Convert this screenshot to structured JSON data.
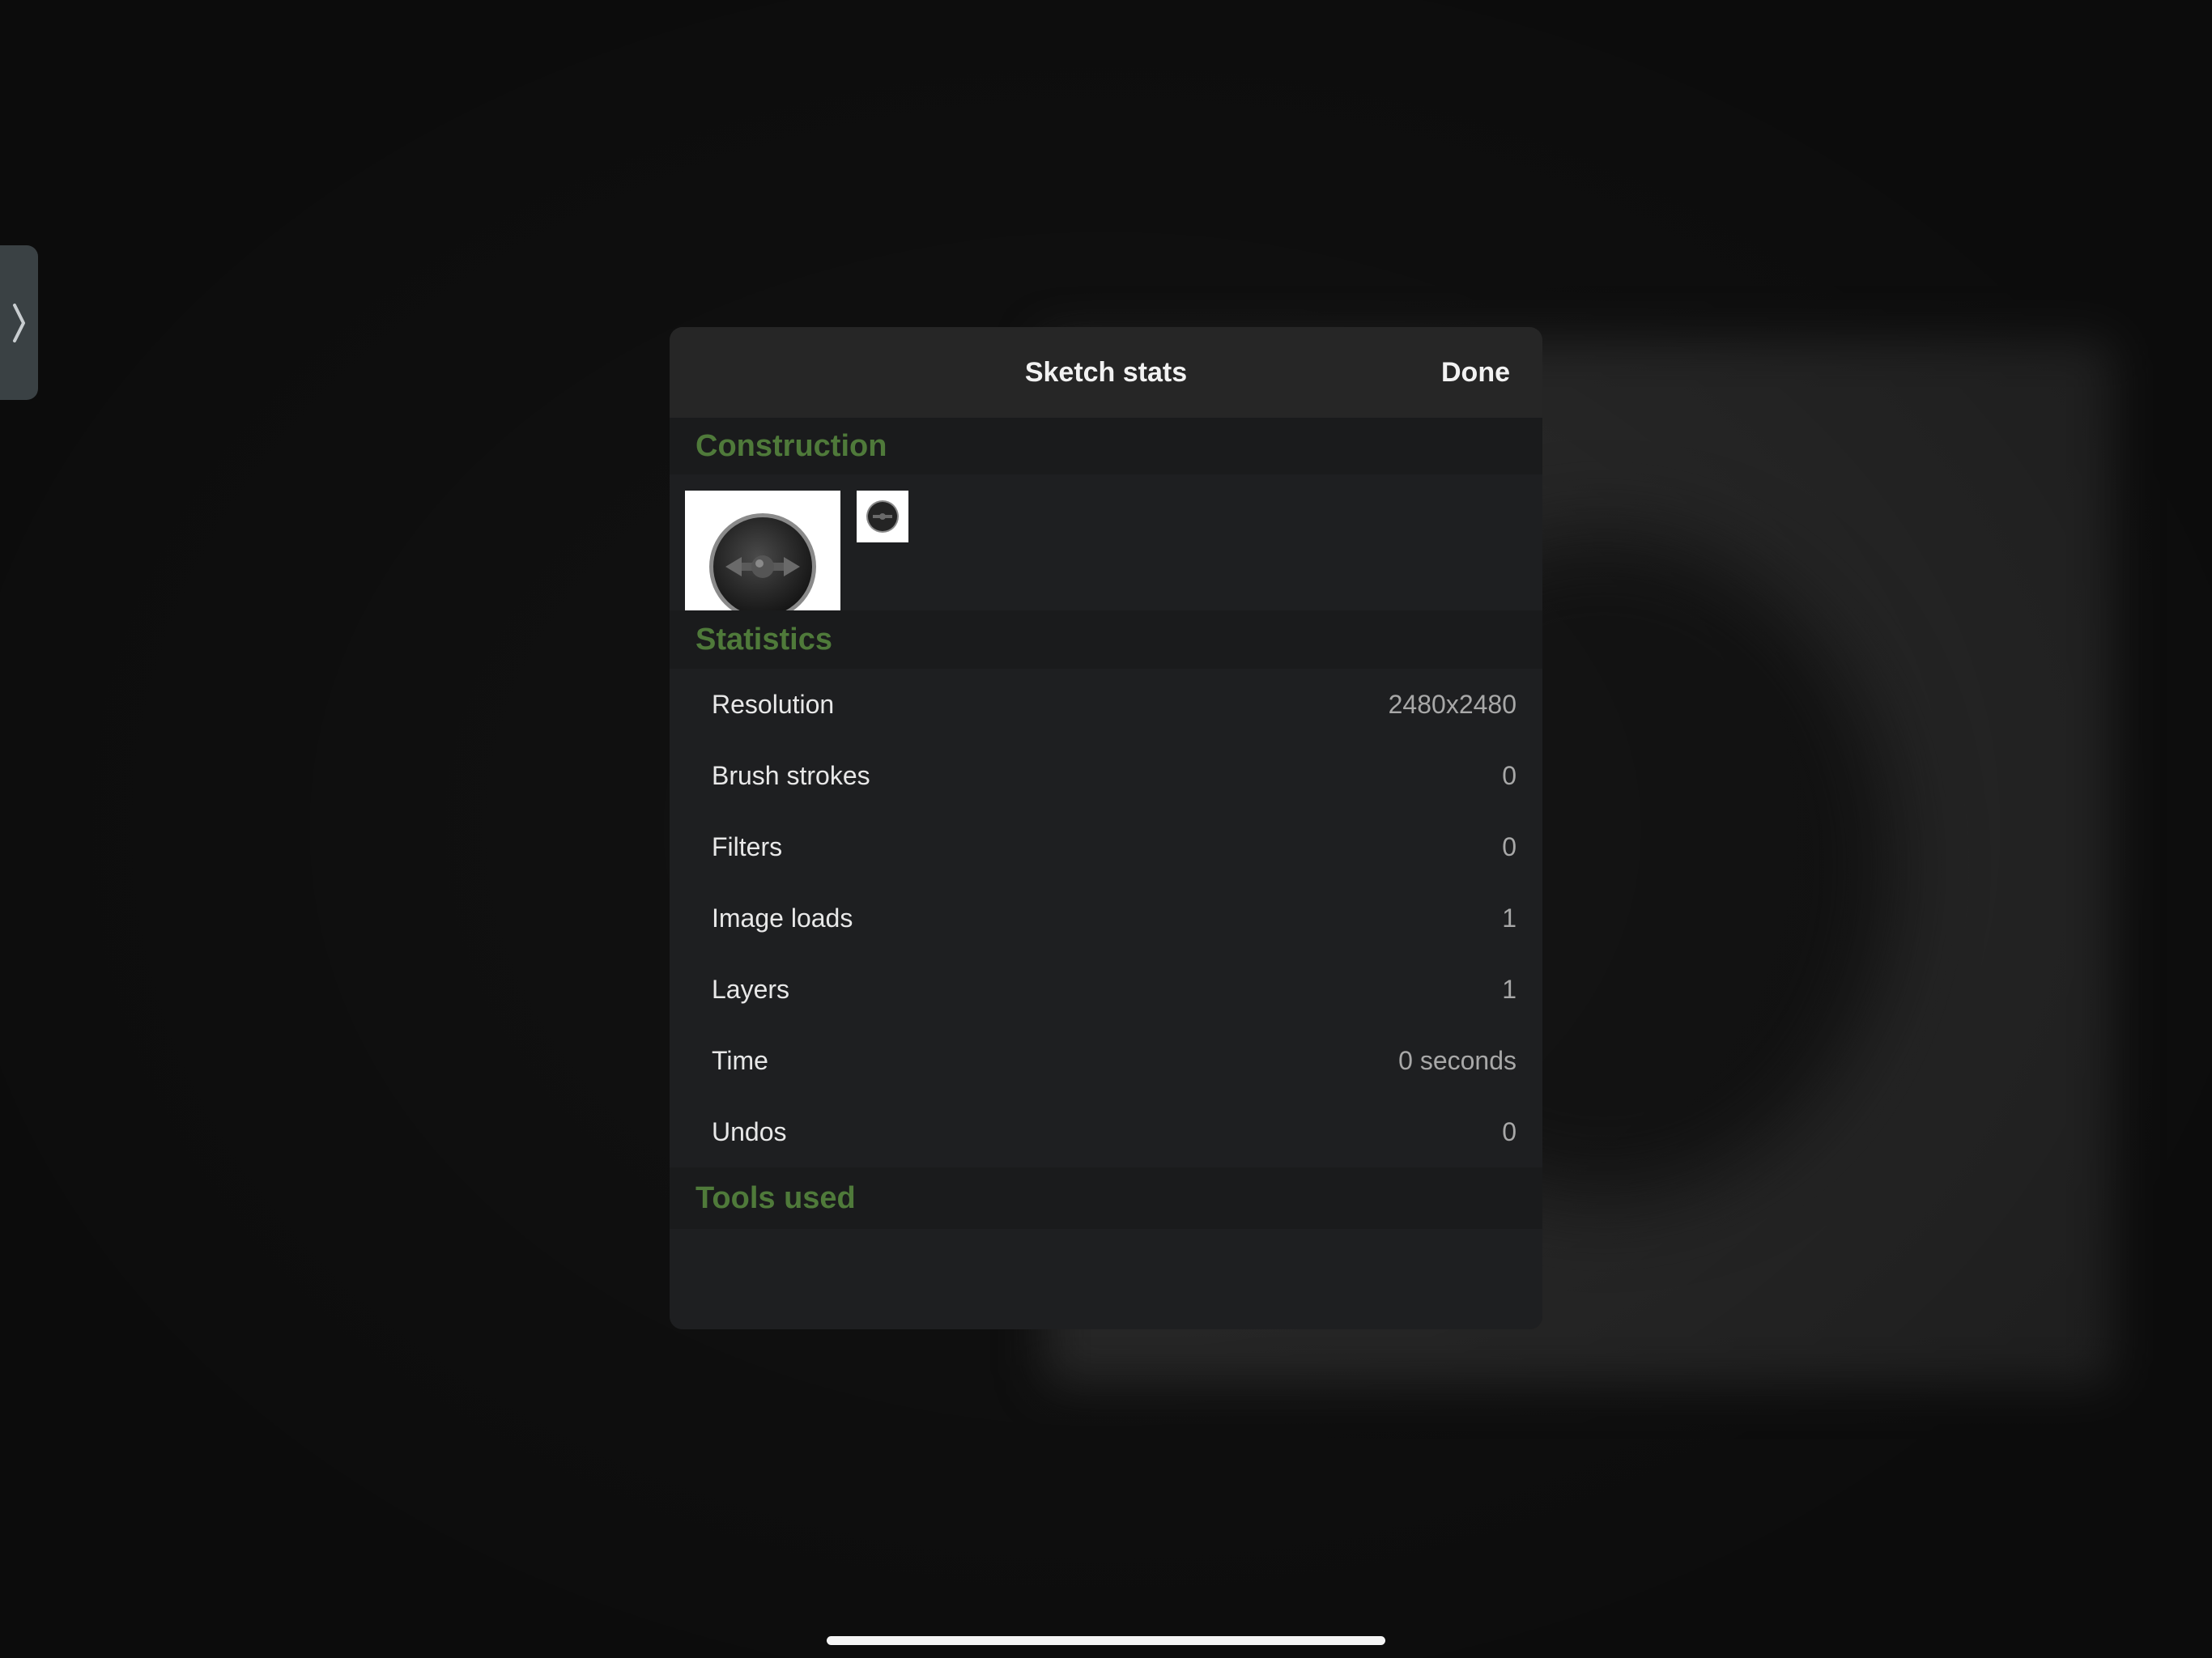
{
  "modal": {
    "title": "Sketch stats",
    "done_label": "Done"
  },
  "sections": {
    "construction": "Construction",
    "statistics": "Statistics",
    "tools_used": "Tools used"
  },
  "construction": {
    "thumbnails": [
      "shield-thumbnail-large",
      "shield-thumbnail-small"
    ]
  },
  "statistics": [
    {
      "label": "Resolution",
      "value": "2480x2480"
    },
    {
      "label": "Brush strokes",
      "value": "0"
    },
    {
      "label": "Filters",
      "value": "0"
    },
    {
      "label": "Image loads",
      "value": "1"
    },
    {
      "label": "Layers",
      "value": "1"
    },
    {
      "label": "Time",
      "value": "0 seconds"
    },
    {
      "label": "Undos",
      "value": "0"
    }
  ],
  "colors": {
    "section_heading": "#4f7a3a",
    "modal_background": "#1c1d1f",
    "header_background": "#262626"
  },
  "icons": {
    "side_tab": "chevron-right-icon"
  }
}
